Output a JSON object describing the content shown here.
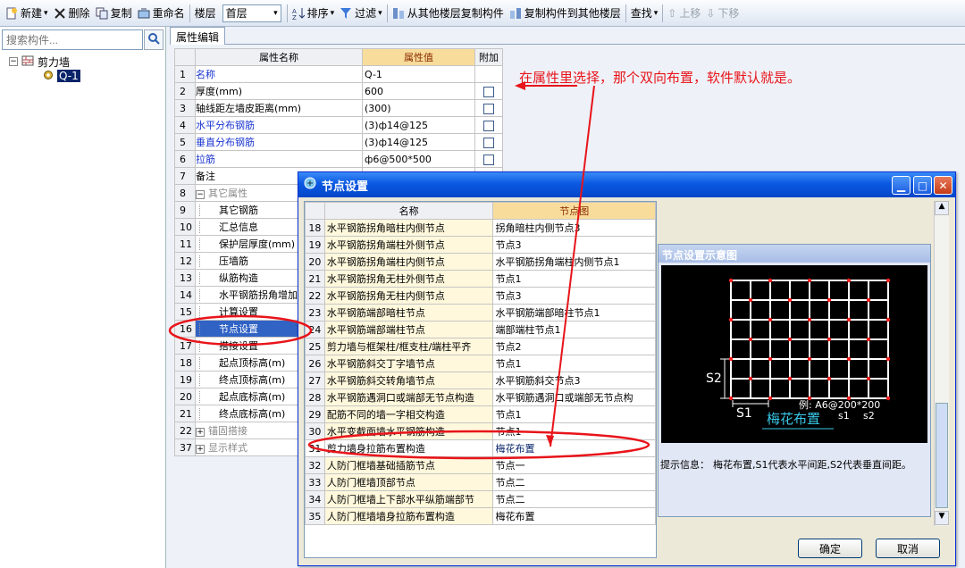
{
  "toolbar": {
    "new_label": "新建",
    "delete_label": "删除",
    "copy_label": "复制",
    "rename_label": "重命名",
    "floor_label": "楼层",
    "floor_value": "首层",
    "sort_label": "排序",
    "filter_label": "过滤",
    "copy_from_label": "从其他楼层复制构件",
    "copy_to_label": "复制构件到其他楼层",
    "find_label": "查找",
    "up_label": "上移",
    "down_label": "下移"
  },
  "left_panel": {
    "search_placeholder": "搜索构件...",
    "tree_root": "剪力墙",
    "tree_child": "Q-1"
  },
  "tab_label": "属性编辑",
  "property_table": {
    "headers": [
      "属性名称",
      "属性值",
      "附加"
    ],
    "rows": [
      {
        "n": "1",
        "name": "名称",
        "value": "Q-1",
        "cb": false
      },
      {
        "n": "2",
        "name": "厚度(mm)",
        "value": "600",
        "cb": true
      },
      {
        "n": "3",
        "name": "轴线距左墙皮距离(mm)",
        "value": "(300)",
        "cb": true
      },
      {
        "n": "4",
        "name": "水平分布钢筋",
        "value": "(3)ф14@125",
        "cb": true
      },
      {
        "n": "5",
        "name": "垂直分布钢筋",
        "value": "(3)ф14@125",
        "cb": true
      },
      {
        "n": "6",
        "name": "拉筋",
        "value": "ф6@500*500",
        "cb": true
      },
      {
        "n": "7",
        "name": "备注",
        "value": "",
        "cb": false
      },
      {
        "n": "8",
        "name": "其它属性",
        "value": "",
        "cb": false
      },
      {
        "n": "9",
        "name": "其它钢筋",
        "value": "",
        "cb": false
      },
      {
        "n": "10",
        "name": "汇总信息",
        "value": "",
        "cb": false
      },
      {
        "n": "11",
        "name": "保护层厚度(mm)",
        "value": "",
        "cb": false
      },
      {
        "n": "12",
        "name": "压墙筋",
        "value": "",
        "cb": false
      },
      {
        "n": "13",
        "name": "纵筋构造",
        "value": "",
        "cb": false
      },
      {
        "n": "14",
        "name": "水平钢筋拐角增加",
        "value": "",
        "cb": false
      },
      {
        "n": "15",
        "name": "计算设置",
        "value": "",
        "cb": false
      },
      {
        "n": "16",
        "name": "节点设置",
        "value": "",
        "cb": false
      },
      {
        "n": "17",
        "name": "搭接设置",
        "value": "",
        "cb": false
      },
      {
        "n": "18",
        "name": "起点顶标高(m)",
        "value": "",
        "cb": false
      },
      {
        "n": "19",
        "name": "终点顶标高(m)",
        "value": "",
        "cb": false
      },
      {
        "n": "20",
        "name": "起点底标高(m)",
        "value": "",
        "cb": false
      },
      {
        "n": "21",
        "name": "终点底标高(m)",
        "value": "",
        "cb": false
      },
      {
        "n": "22",
        "name": "锚固搭接",
        "value": "",
        "cb": false
      },
      {
        "n": "37",
        "name": "显示样式",
        "value": "",
        "cb": false
      }
    ]
  },
  "annotation": "在属性里选择，那个双向布置，软件默认就是。",
  "dialog": {
    "title": "节点设置",
    "headers": [
      "名称",
      "节点图"
    ],
    "rows": [
      {
        "n": "18",
        "name": "水平钢筋拐角暗柱内侧节点",
        "node": "拐角暗柱内侧节点3"
      },
      {
        "n": "19",
        "name": "水平钢筋拐角端柱外侧节点",
        "node": "节点3"
      },
      {
        "n": "20",
        "name": "水平钢筋拐角端柱内侧节点",
        "node": "水平钢筋拐角端柱内侧节点1"
      },
      {
        "n": "21",
        "name": "水平钢筋拐角无柱外侧节点",
        "node": "节点1"
      },
      {
        "n": "22",
        "name": "水平钢筋拐角无柱内侧节点",
        "node": "节点3"
      },
      {
        "n": "23",
        "name": "水平钢筋端部暗柱节点",
        "node": "水平钢筋端部暗柱节点1"
      },
      {
        "n": "24",
        "name": "水平钢筋端部端柱节点",
        "node": "端部端柱节点1"
      },
      {
        "n": "25",
        "name": "剪力墙与框架柱/框支柱/端柱平齐",
        "node": "节点2"
      },
      {
        "n": "26",
        "name": "水平钢筋斜交丁字墙节点",
        "node": "节点1"
      },
      {
        "n": "27",
        "name": "水平钢筋斜交转角墙节点",
        "node": "水平钢筋斜交节点3"
      },
      {
        "n": "28",
        "name": "水平钢筋遇洞口或端部无节点构造",
        "node": "水平钢筋遇洞口或端部无节点构"
      },
      {
        "n": "29",
        "name": "配筋不同的墙一字相交构造",
        "node": "节点1"
      },
      {
        "n": "30",
        "name": "水平变截面墙水平钢筋构造",
        "node": "节点1"
      },
      {
        "n": "31",
        "name": "剪力墙身拉筋布置构造",
        "node": "梅花布置"
      },
      {
        "n": "32",
        "name": "人防门框墙基础插筋节点",
        "node": "节点一"
      },
      {
        "n": "33",
        "name": "人防门框墙顶部节点",
        "node": "节点二"
      },
      {
        "n": "34",
        "name": "人防门框墙上下部水平纵筋端部节",
        "node": "节点二"
      },
      {
        "n": "35",
        "name": "人防门框墙墙身拉筋布置构造",
        "node": "梅花布置"
      }
    ],
    "preview_title": "节点设置示意图",
    "diagram": {
      "s2": "S2",
      "s1": "S1",
      "example": "例: A6@200*200",
      "caption": "梅花布置",
      "sub1": "s1",
      "sub2": "s2"
    },
    "hint_label": "提示信息：",
    "hint_text": "梅花布置,S1代表水平间距,S2代表垂直间距。",
    "ok_label": "确定",
    "cancel_label": "取消"
  },
  "colors": {
    "annotation_red": "#e8141a",
    "title_blue": "#0a58e2",
    "header_orange": "#f8dc9c",
    "name_cell": "#fff8dc"
  }
}
